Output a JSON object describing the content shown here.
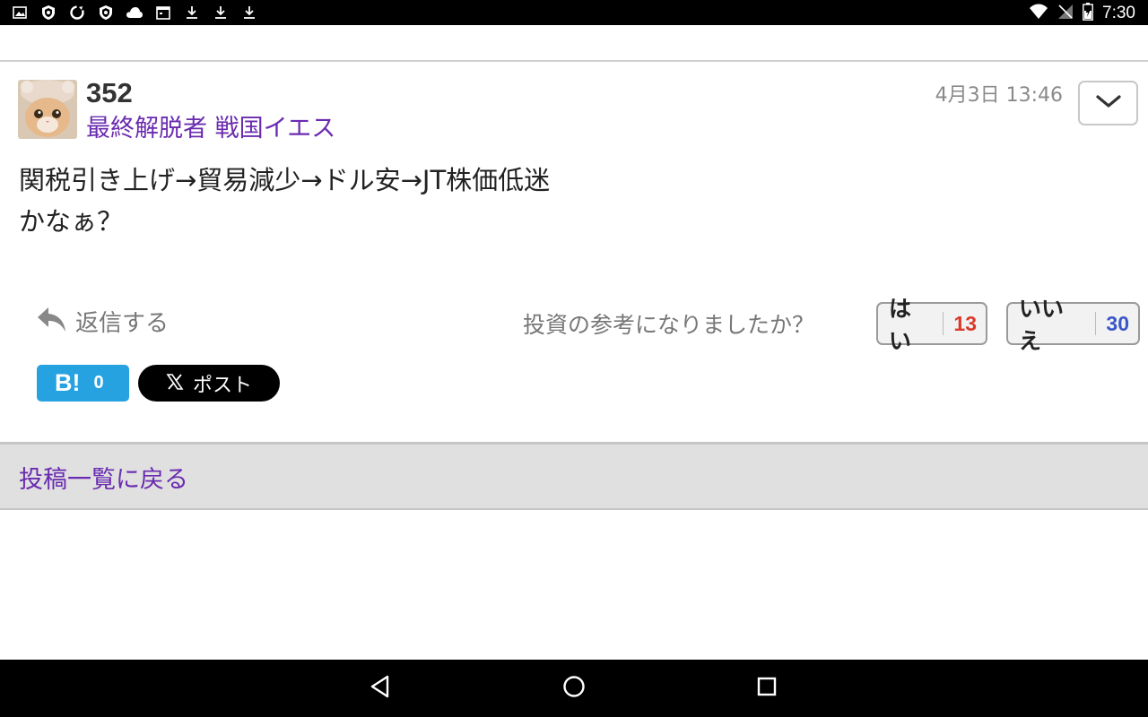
{
  "status_bar": {
    "time": "7:30",
    "left_icons": [
      "image-icon",
      "shield-icon",
      "sync-icon",
      "shield-icon",
      "cloud-icon",
      "calendar-icon",
      "download-icon",
      "download-icon",
      "download-icon"
    ],
    "right_icons": [
      "wifi-icon",
      "no-signal-icon",
      "battery-icon"
    ]
  },
  "post": {
    "number": "352",
    "author": "最終解脱者 戦国イエス",
    "timestamp": "4月3日 13:46",
    "body_lines": [
      "関税引き上げ→貿易減少→ドル安→JT株価低迷",
      "かなぁ？"
    ],
    "reply_label": "返信する",
    "vote_question": "投資の参考になりましたか？",
    "vote_yes": {
      "label": "はい",
      "count": "13",
      "color": "#d93a2b"
    },
    "vote_no": {
      "label": "いいえ",
      "count": "30",
      "color": "#3a56c8"
    },
    "hatena": {
      "logo": "B!",
      "count": "0"
    },
    "x_post": {
      "label": "ポスト"
    }
  },
  "back_link": "投稿一覧に戻る",
  "colors": {
    "accent_purple": "#6a2bb0",
    "hatena_blue": "#27a2e0"
  }
}
